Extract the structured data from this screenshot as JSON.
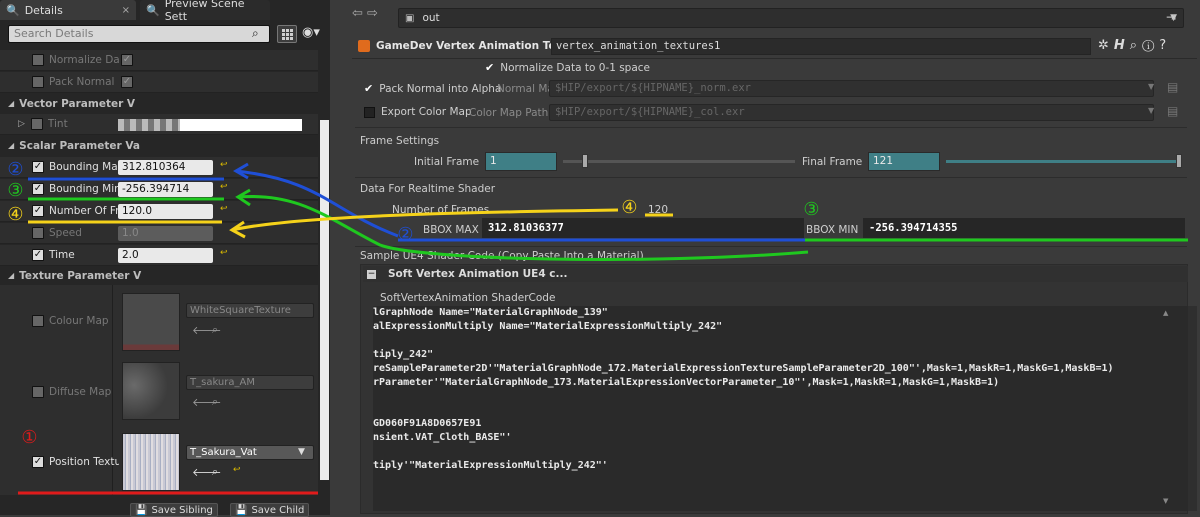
{
  "left_panel": {
    "tabs": [
      {
        "label": "Details",
        "close": "×"
      },
      {
        "label": "Preview Scene Sett",
        "close": ""
      }
    ],
    "search_placeholder": "Search Details",
    "rows_top": [
      {
        "label": "Normalize Data",
        "checked": false
      },
      {
        "label": "Pack Normal",
        "checked": false
      }
    ],
    "vector_category": "Vector Parameter V",
    "tint_label": "Tint",
    "scalar_category": "Scalar Parameter Va",
    "scalar_params": [
      {
        "label": "Bounding Max",
        "value": "312.810364",
        "enabled": true
      },
      {
        "label": "Bounding Min",
        "value": "-256.394714",
        "enabled": true
      },
      {
        "label": "Number Of Fran",
        "value": "120.0",
        "enabled": true
      },
      {
        "label": "Speed",
        "value": "1.0",
        "enabled": false
      },
      {
        "label": "Time",
        "value": "2.0",
        "enabled": true
      }
    ],
    "texture_category": "Texture Parameter V",
    "textures": [
      {
        "label": "Colour Map",
        "asset": "WhiteSquareTexture",
        "enabled": false
      },
      {
        "label": "Diffuse Map",
        "asset": "T_sakura_AM",
        "enabled": false
      },
      {
        "label": "Position Textur",
        "asset": "T_Sakura_Vat",
        "enabled": true
      }
    ],
    "buttons": {
      "save_sibling": "Save Sibling",
      "save_child": "Save Child"
    }
  },
  "right_panel": {
    "path": "out",
    "node_type": "GameDev Vertex Animation Textures",
    "node_name": "vertex_animation_textures1",
    "normalize_label": "Normalize Data to 0-1 space",
    "pack_normal_label": "Pack Normal into Alpha",
    "normal_map_path_label": "Normal Map Path",
    "normal_map_path": "$HIP/export/${HIPNAME}_norm.exr",
    "export_color_label": "Export Color Map",
    "color_map_path_label": "Color Map Path",
    "color_map_path": "$HIP/export/${HIPNAME}_col.exr",
    "frame_settings": "Frame Settings",
    "initial_frame_label": "Initial Frame",
    "initial_frame": "1",
    "final_frame_label": "Final Frame",
    "final_frame": "121",
    "realtime_section": "Data For Realtime Shader",
    "num_frames_label": "Number of Frames",
    "num_frames": "120",
    "bbox_max_label": "BBOX MAX",
    "bbox_max": "312.81036377",
    "bbox_min_label": "BBOX MIN",
    "bbox_min": "-256.394714355",
    "sample_section": "Sample UE4 Shader Code (Copy Paste Into a Material)",
    "soft_vat_header": "Soft Vertex Animation UE4 c...",
    "shader_code_label": "SoftVertexAnimation ShaderCode",
    "code_lines": [
      "lGraphNode Name=\"MaterialGraphNode_139\"",
      "alExpressionMultiply Name=\"MaterialExpressionMultiply_242\"",
      "",
      "tiply_242\"",
      "reSampleParameter2D'\"MaterialGraphNode_172.MaterialExpressionTextureSampleParameter2D_100\"',Mask=1,MaskR=1,MaskG=1,MaskB=1)",
      "rParameter'\"MaterialGraphNode_173.MaterialExpressionVectorParameter_10\"',Mask=1,MaskR=1,MaskG=1,MaskB=1)",
      "",
      "",
      "GD060F91A8D0657E91",
      "nsient.VAT_Cloth_BASE\"'",
      "",
      "tiply'\"MaterialExpressionMultiply_242\"'"
    ]
  },
  "annotations": {
    "circle_1": "①",
    "circle_2": "②",
    "circle_3": "③",
    "circle_4": "④"
  },
  "colors": {
    "blue": "#1f4fd6",
    "green": "#1fc81f",
    "yellow": "#f5d21a",
    "red": "#e01b1b",
    "teal_field": "#3f7f86"
  }
}
